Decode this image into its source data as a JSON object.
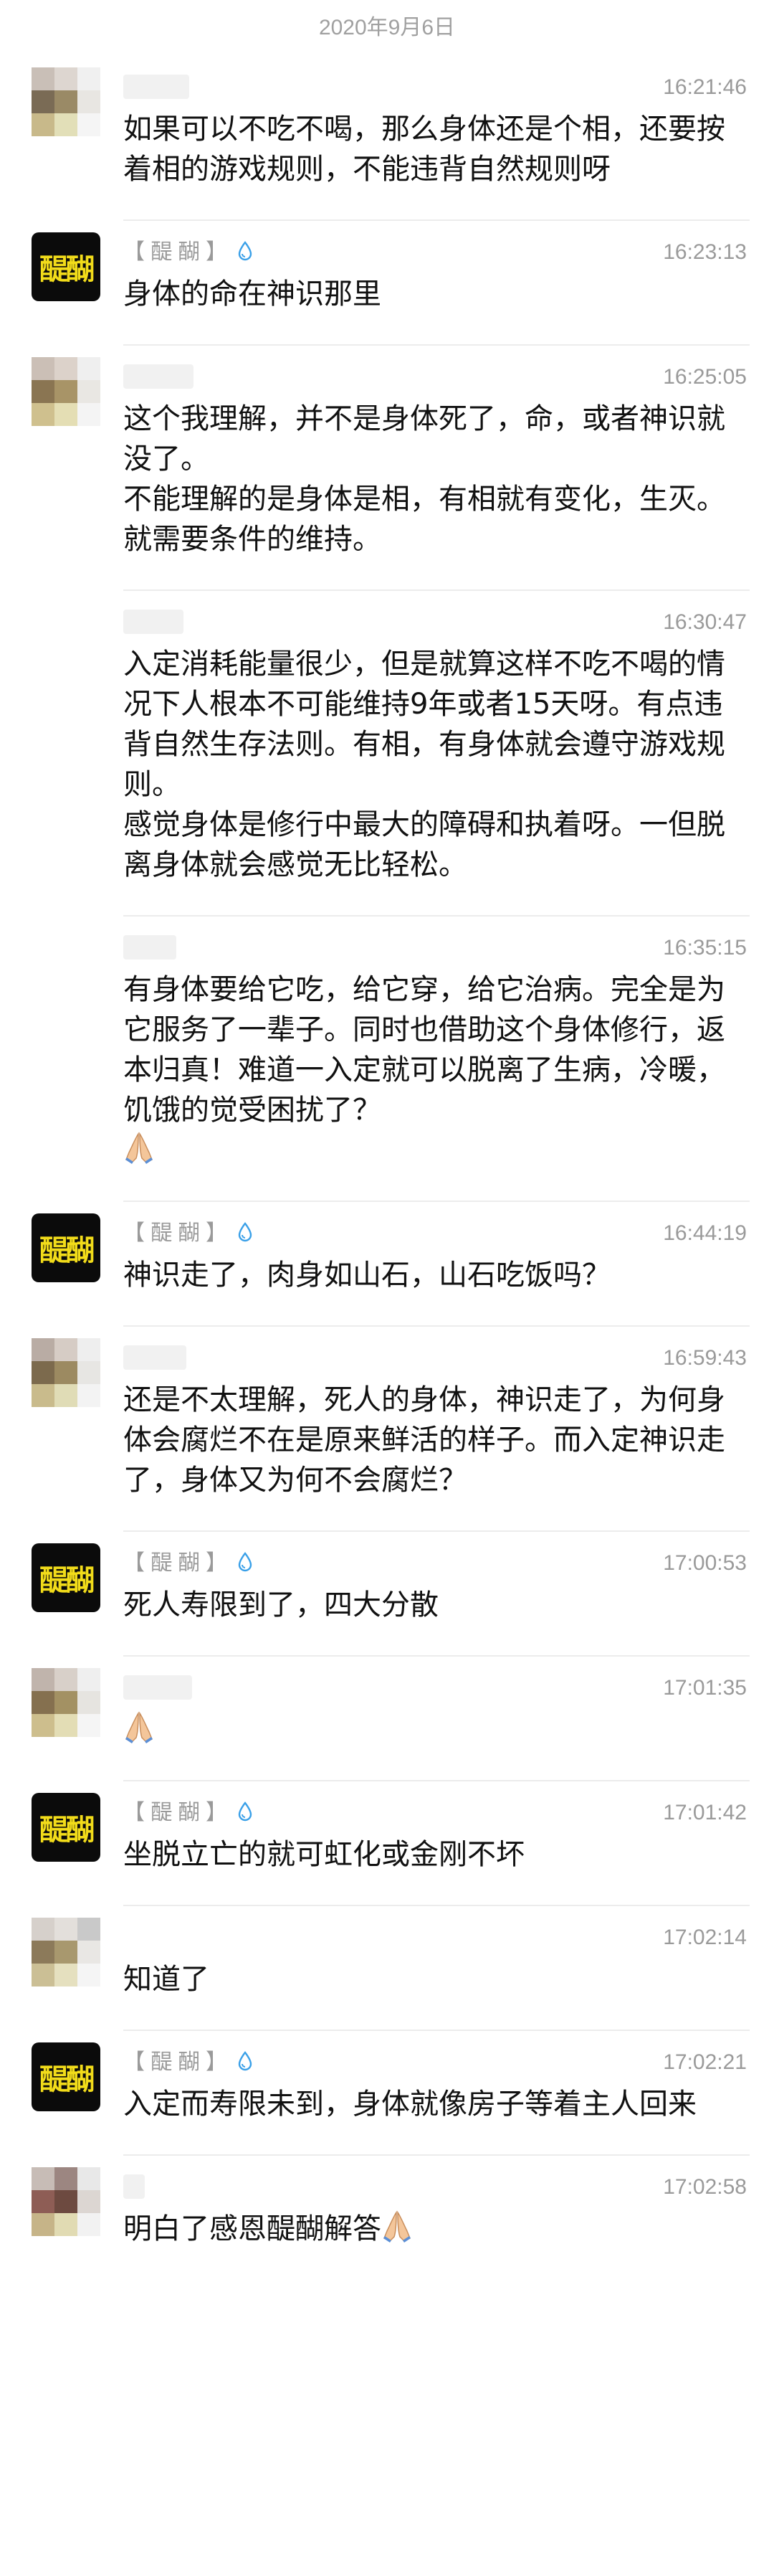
{
  "date_header": "2020年9月6日",
  "messages": [
    {
      "sender": "",
      "time": "16:21:46",
      "avatar": "blur-a",
      "text": "如果可以不吃不喝，那么身体还是个相，还要按着相的游戏规则，不能违背自然规则呀"
    },
    {
      "sender": "【 醍 醐 】",
      "time": "16:23:13",
      "avatar": "xinghu",
      "text": "身体的命在神识那里"
    },
    {
      "sender": "",
      "time": "16:25:05",
      "avatar": "blur-b",
      "text": "这个我理解，并不是身体死了，命，或者神识就没了。\n不能理解的是身体是相，有相就有变化，生灭。就需要条件的维持。"
    },
    {
      "sender": "",
      "time": "16:30:47",
      "avatar": "none",
      "text": "入定消耗能量很少，但是就算这样不吃不喝的情况下人根本不可能维持9年或者15天呀。有点违背自然生存法则。有相，有身体就会遵守游戏规则。\n感觉身体是修行中最大的障碍和执着呀。一但脱离身体就会感觉无比轻松。"
    },
    {
      "sender": "",
      "time": "16:35:15",
      "avatar": "none",
      "text": "有身体要给它吃，给它穿，给它治病。完全是为它服务了一辈子。同时也借助这个身体修行，返本归真！难道一入定就可以脱离了生病，冷暖，饥饿的觉受困扰了？",
      "pray": true
    },
    {
      "sender": "【 醍 醐 】",
      "time": "16:44:19",
      "avatar": "xinghu",
      "text": "神识走了，肉身如山石，山石吃饭吗？"
    },
    {
      "sender": "",
      "time": "16:59:43",
      "avatar": "blur-c",
      "text": "还是不太理解，死人的身体，神识走了，为何身体会腐烂不在是原来鲜活的样子。而入定神识走了，身体又为何不会腐烂？"
    },
    {
      "sender": "【 醍 醐 】",
      "time": "17:00:53",
      "avatar": "xinghu",
      "text": "死人寿限到了，四大分散"
    },
    {
      "sender": "",
      "time": "17:01:35",
      "avatar": "blur-d",
      "text": "",
      "pray": true
    },
    {
      "sender": "【 醍 醐 】",
      "time": "17:01:42",
      "avatar": "xinghu",
      "text": "坐脱立亡的就可虹化或金刚不坏"
    },
    {
      "sender": "",
      "time": "17:02:14",
      "avatar": "blur-e",
      "text": "知道了"
    },
    {
      "sender": "【 醍 醐 】",
      "time": "17:02:21",
      "avatar": "xinghu",
      "text": "入定而寿限未到，身体就像房子等着主人回来"
    },
    {
      "sender": "",
      "time": "17:02:58",
      "avatar": "blur-f",
      "text": "明白了感恩醍醐解答",
      "pray": true
    }
  ],
  "avatar_glyph": "醍醐",
  "colors": {
    "text": "#111111",
    "meta": "#9a9a9a",
    "divider": "#ececec",
    "xinghu_bg": "#0b0b0b",
    "xinghu_fg": "#f2dc1a",
    "drop": "#3aa0e8"
  },
  "icons": {
    "drop": "water-drop-icon",
    "pray": "folded-hands-icon"
  }
}
